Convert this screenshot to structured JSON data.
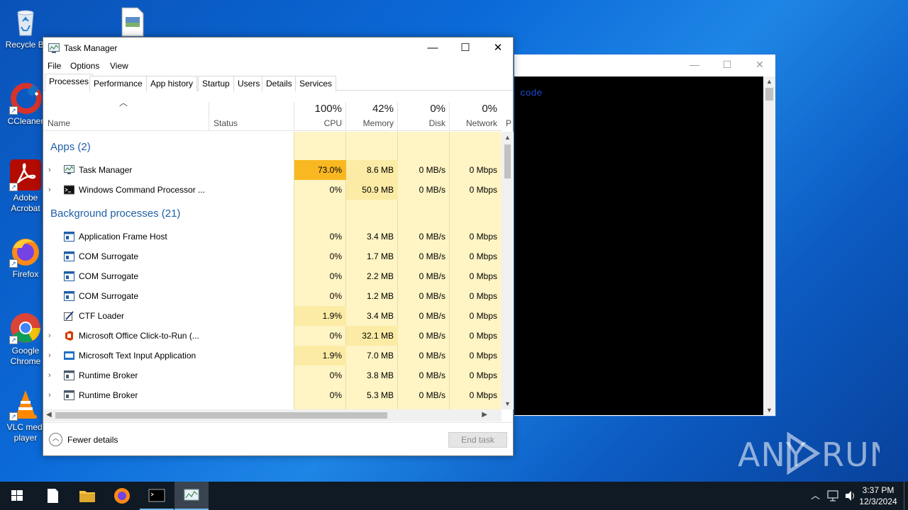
{
  "desktop": {
    "icons": [
      {
        "label": "Recycle Bin",
        "icon": "recycle-bin-icon"
      },
      {
        "label": "CCleaner",
        "icon": "ccleaner-icon"
      },
      {
        "label": "Adobe Acrobat",
        "icon": "acrobat-icon"
      },
      {
        "label": "Firefox",
        "icon": "firefox-icon"
      },
      {
        "label": "Google Chrome",
        "icon": "chrome-icon"
      },
      {
        "label": "VLC media player",
        "icon": "vlc-icon"
      }
    ],
    "visible_labels": {
      "recycle": "Recycle Bi",
      "ccleaner": "CCleaner",
      "acrobat_1": "Adobe",
      "acrobat_2": "Acrobat",
      "firefox": "Firefox",
      "chrome_1": "Google",
      "chrome_2": "Chrome",
      "vlc_1": "VLC medi",
      "vlc_2": "player"
    }
  },
  "console_window": {
    "text_line": "code"
  },
  "task_manager": {
    "title": "Task Manager",
    "menu": [
      "File",
      "Options",
      "View"
    ],
    "tabs": [
      "Processes",
      "Performance",
      "App history",
      "Startup",
      "Users",
      "Details",
      "Services"
    ],
    "active_tab": "Processes",
    "columns": {
      "name": "Name",
      "status": "Status",
      "cpu": {
        "pct": "100%",
        "label": "CPU"
      },
      "memory": {
        "pct": "42%",
        "label": "Memory"
      },
      "disk": {
        "pct": "0%",
        "label": "Disk"
      },
      "network": {
        "pct": "0%",
        "label": "Network"
      },
      "overflow": "P"
    },
    "groups": {
      "apps": "Apps (2)",
      "background": "Background processes (21)"
    },
    "apps": [
      {
        "name": "Task Manager",
        "cpu": "73.0%",
        "memory": "8.6 MB",
        "disk": "0 MB/s",
        "network": "0 Mbps"
      },
      {
        "name": "Windows Command Processor ...",
        "cpu": "0%",
        "memory": "50.9 MB",
        "disk": "0 MB/s",
        "network": "0 Mbps"
      }
    ],
    "background": [
      {
        "name": "Application Frame Host",
        "cpu": "0%",
        "memory": "3.4 MB",
        "disk": "0 MB/s",
        "network": "0 Mbps"
      },
      {
        "name": "COM Surrogate",
        "cpu": "0%",
        "memory": "1.7 MB",
        "disk": "0 MB/s",
        "network": "0 Mbps"
      },
      {
        "name": "COM Surrogate",
        "cpu": "0%",
        "memory": "2.2 MB",
        "disk": "0 MB/s",
        "network": "0 Mbps"
      },
      {
        "name": "COM Surrogate",
        "cpu": "0%",
        "memory": "1.2 MB",
        "disk": "0 MB/s",
        "network": "0 Mbps"
      },
      {
        "name": "CTF Loader",
        "cpu": "1.9%",
        "memory": "3.4 MB",
        "disk": "0 MB/s",
        "network": "0 Mbps"
      },
      {
        "name": "Microsoft Office Click-to-Run (...",
        "cpu": "0%",
        "memory": "32.1 MB",
        "disk": "0 MB/s",
        "network": "0 Mbps"
      },
      {
        "name": "Microsoft Text Input Application",
        "cpu": "1.9%",
        "memory": "7.0 MB",
        "disk": "0 MB/s",
        "network": "0 Mbps"
      },
      {
        "name": "Runtime Broker",
        "cpu": "0%",
        "memory": "3.8 MB",
        "disk": "0 MB/s",
        "network": "0 Mbps"
      },
      {
        "name": "Runtime Broker",
        "cpu": "0%",
        "memory": "5.3 MB",
        "disk": "0 MB/s",
        "network": "0 Mbps"
      }
    ],
    "footer": {
      "fewer_details": "Fewer details",
      "end_task": "End task"
    }
  },
  "taskbar": {
    "time": "3:37 PM",
    "date": "12/3/2024"
  },
  "watermark": "ANY RUN"
}
